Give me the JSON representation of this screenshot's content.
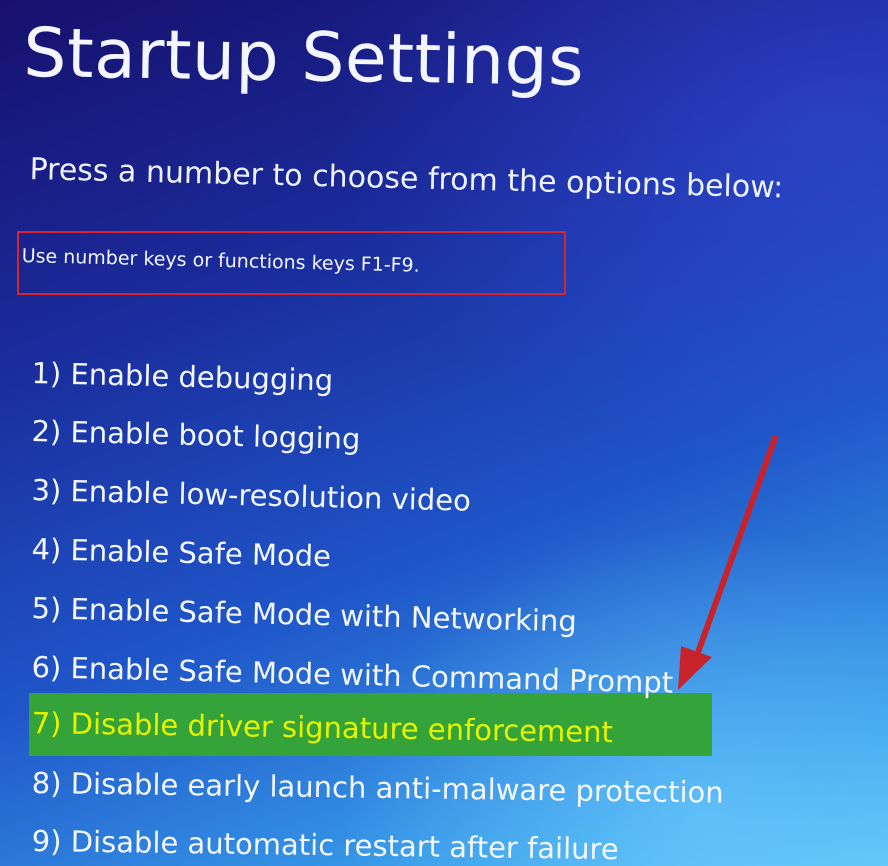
{
  "screen": {
    "title": "Startup Settings",
    "subtitle": "Press a number to choose from the options below:",
    "hint": "Use number keys or functions keys F1-F9."
  },
  "options": [
    {
      "label": "1) Enable debugging"
    },
    {
      "label": "2) Enable boot logging"
    },
    {
      "label": "3) Enable low-resolution video"
    },
    {
      "label": "4) Enable Safe Mode"
    },
    {
      "label": "5) Enable Safe Mode with Networking"
    },
    {
      "label": "6) Enable Safe Mode with Command Prompt"
    },
    {
      "label": "7) Disable driver signature enforcement",
      "highlighted": true
    },
    {
      "label": "8) Disable early launch anti-malware protection"
    },
    {
      "label": "9) Disable automatic restart after failure"
    }
  ],
  "annotations": {
    "hint_box_color": "#d8242e",
    "arrow_color": "#c8232b",
    "highlight_color": "#33a33a",
    "highlight_text_color": "#e6f400"
  }
}
